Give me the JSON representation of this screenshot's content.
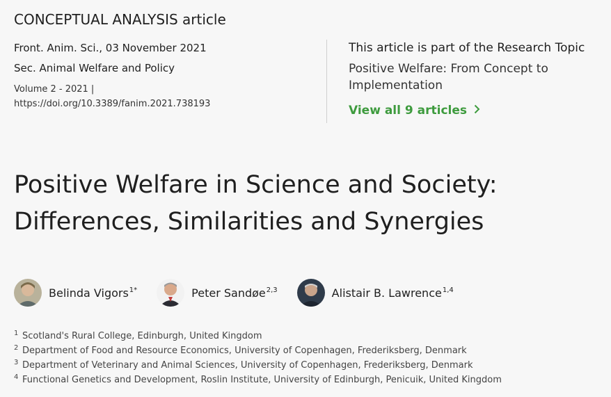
{
  "article_type": "CONCEPTUAL ANALYSIS article",
  "meta": {
    "journal_date": "Front. Anim. Sci., 03 November 2021",
    "section": "Sec. Animal Welfare and Policy",
    "volume": "Volume 2 - 2021 |",
    "doi": "https://doi.org/10.3389/fanim.2021.738193"
  },
  "topic": {
    "heading": "This article is part of the Research Topic",
    "name": "Positive Welfare: From Concept to Implementation",
    "view_all": "View all 9 articles",
    "accent_color": "#3e9b3e"
  },
  "title": "Positive Welfare in Science and Society: Differences, Similarities and Synergies",
  "authors": [
    {
      "name": "Belinda Vigors",
      "sup": "1*"
    },
    {
      "name": "Peter Sandøe",
      "sup": "2,3"
    },
    {
      "name": "Alistair B. Lawrence",
      "sup": "1,4"
    }
  ],
  "affiliations": [
    {
      "num": "1",
      "text": "Scotland's Rural College, Edinburgh, United Kingdom"
    },
    {
      "num": "2",
      "text": "Department of Food and Resource Economics, University of Copenhagen, Frederiksberg, Denmark"
    },
    {
      "num": "3",
      "text": "Department of Veterinary and Animal Sciences, University of Copenhagen, Frederiksberg, Denmark"
    },
    {
      "num": "4",
      "text": "Functional Genetics and Development, Roslin Institute, University of Edinburgh, Penicuik, United Kingdom"
    }
  ]
}
